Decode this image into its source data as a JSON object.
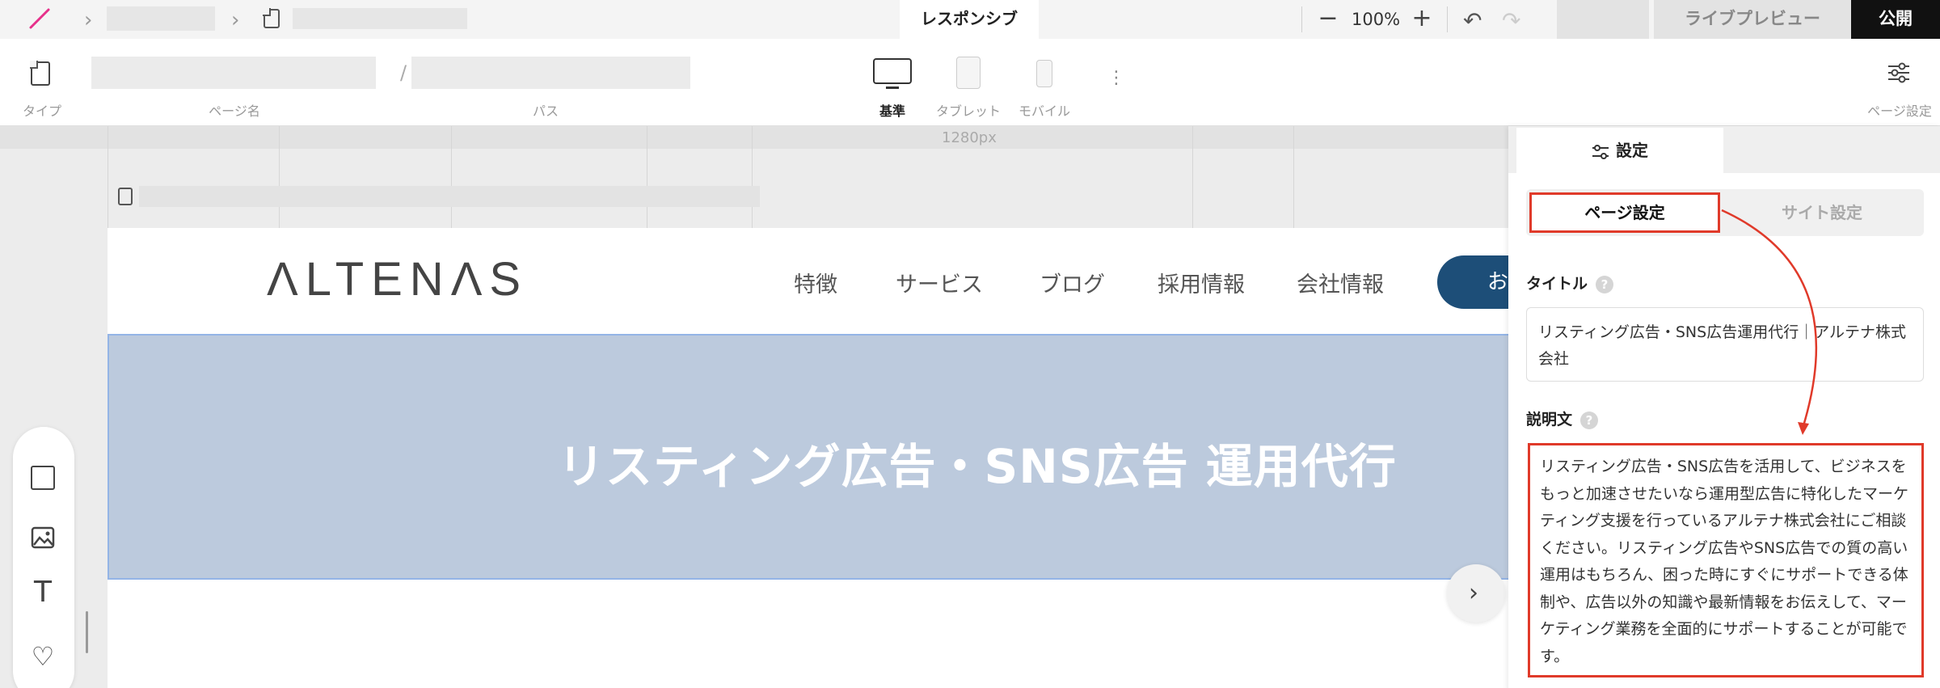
{
  "topbar": {
    "tab_responsive": "レスポンシブ",
    "zoom": "100%",
    "zoom_out_glyph": "−",
    "zoom_in_glyph": "+",
    "undo_glyph": "↶",
    "redo_glyph": "↷",
    "live_preview": "ライブプレビュー",
    "publish": "公開"
  },
  "toolbar": {
    "type_label": "タイプ",
    "page_name_label": "ページ名",
    "path_label": "パス",
    "separator": "/",
    "device_base": "基準",
    "device_tablet": "タブレット",
    "device_mobile": "モバイル",
    "page_settings_label": "ページ設定",
    "more_glyph": "⋮"
  },
  "canvas": {
    "width_label": "1280px",
    "brand": "ΛLTENΛS",
    "nav": [
      "特徴",
      "サービス",
      "ブログ",
      "採用情報",
      "会社情報"
    ],
    "cta_text": "お",
    "hero_title": "リスティング広告・SNS広告 運用代行",
    "next_glyph": "›"
  },
  "tools": {
    "text_glyph": "T",
    "heart_glyph": "♡"
  },
  "panel": {
    "tab_settings": "設定",
    "seg_page": "ページ設定",
    "seg_site": "サイト設定",
    "title_label": "タイトル",
    "title_value": "リスティング広告・SNS広告運用代行｜アルテナ株式会社",
    "desc_label": "説明文",
    "desc_value": "リスティング広告・SNS広告を活用して、ビジネスをもっと加速させたいなら運用型広告に特化したマーケティング支援を行っているアルテナ株式会社にご相談ください。リスティング広告やSNS広告での質の高い運用はもちろん、困った時にすぐにサポートできる体制や、広告以外の知識や最新情報をお伝えして、マーケティング業務を全面的にサポートすることが可能です。",
    "help_glyph": "?"
  },
  "colors": {
    "highlight": "#e03a2a",
    "cta": "#1d4e78",
    "hero": "#bccadd"
  }
}
